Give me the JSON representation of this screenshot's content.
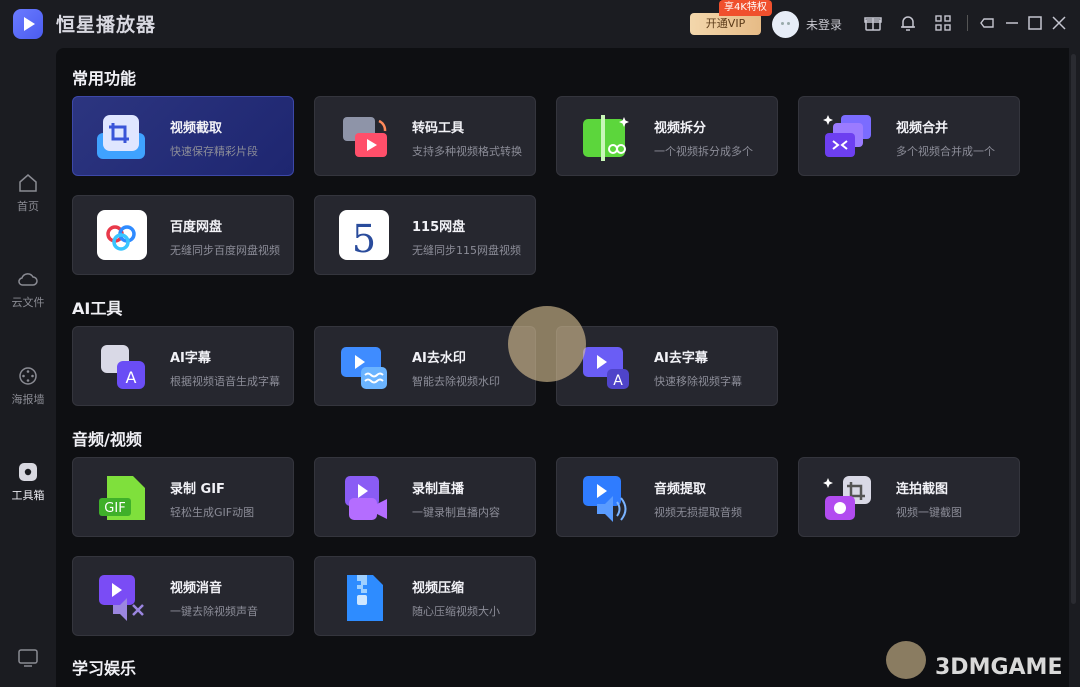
{
  "app": {
    "title": "恒星播放器"
  },
  "header": {
    "vip_button": "开通VIP",
    "vip_tag": "享4K特权",
    "login": "未登录"
  },
  "sidebar": {
    "items": [
      {
        "label": "首页",
        "icon": "home-icon"
      },
      {
        "label": "云文件",
        "icon": "cloud-icon"
      },
      {
        "label": "海报墙",
        "icon": "poster-icon"
      },
      {
        "label": "工具箱",
        "icon": "toolbox-icon"
      }
    ]
  },
  "sections": [
    {
      "title": "常用功能",
      "cards": [
        {
          "title": "视频截取",
          "desc": "快速保存精彩片段"
        },
        {
          "title": "转码工具",
          "desc": "支持多种视频格式转换"
        },
        {
          "title": "视频拆分",
          "desc": "一个视频拆分成多个"
        },
        {
          "title": "视频合并",
          "desc": "多个视频合并成一个"
        },
        {
          "title": "百度网盘",
          "desc": "无缝同步百度网盘视频"
        },
        {
          "title": "115网盘",
          "desc": "无缝同步115网盘视频"
        }
      ]
    },
    {
      "title": "AI工具",
      "cards": [
        {
          "title": "AI字幕",
          "desc": "根据视频语音生成字幕"
        },
        {
          "title": "AI去水印",
          "desc": "智能去除视频水印"
        },
        {
          "title": "AI去字幕",
          "desc": "快速移除视频字幕"
        }
      ]
    },
    {
      "title": "音频/视频",
      "cards": [
        {
          "title": "录制 GIF",
          "desc": "轻松生成GIF动图"
        },
        {
          "title": "录制直播",
          "desc": "一键录制直播内容"
        },
        {
          "title": "音频提取",
          "desc": "视频无损提取音频"
        },
        {
          "title": "连拍截图",
          "desc": "视频一键截图"
        },
        {
          "title": "视频消音",
          "desc": "一键去除视频声音"
        },
        {
          "title": "视频压缩",
          "desc": "随心压缩视频大小"
        }
      ]
    },
    {
      "title": "学习娱乐",
      "cards": []
    }
  ],
  "icons": {
    "gif_text": "GIF",
    "pan115_text": "5"
  },
  "watermark": "3DMGAME"
}
